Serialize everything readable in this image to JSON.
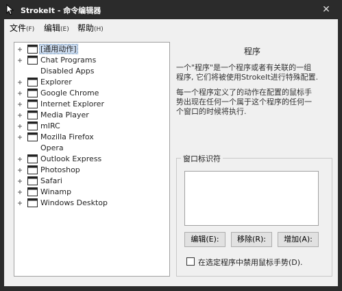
{
  "titlebar": {
    "title": "StrokeIt - 命令编辑器",
    "close_label": "✕"
  },
  "menubar": {
    "items": [
      {
        "label": "文件",
        "accel": "(F)"
      },
      {
        "label": "编辑",
        "accel": "(E)"
      },
      {
        "label": "帮助",
        "accel": "(H)"
      }
    ]
  },
  "tree": {
    "items": [
      {
        "label": "[通用动作]",
        "expandable": true,
        "selected": true
      },
      {
        "label": "Chat Programs",
        "expandable": true
      },
      {
        "label": "Disabled Apps",
        "expandable": false
      },
      {
        "label": "Explorer",
        "expandable": true
      },
      {
        "label": "Google Chrome",
        "expandable": true
      },
      {
        "label": "Internet Explorer",
        "expandable": true
      },
      {
        "label": "Media Player",
        "expandable": true
      },
      {
        "label": "mIRC",
        "expandable": true
      },
      {
        "label": "Mozilla Firefox",
        "expandable": true
      },
      {
        "label": "Opera",
        "expandable": false
      },
      {
        "label": "Outlook Express",
        "expandable": true
      },
      {
        "label": "Photoshop",
        "expandable": true
      },
      {
        "label": "Safari",
        "expandable": true
      },
      {
        "label": "Winamp",
        "expandable": true
      },
      {
        "label": "Windows Desktop",
        "expandable": true
      }
    ]
  },
  "panel": {
    "heading": "程序",
    "paragraph1_lines": [
      "一个\"程序\"是一个程序或者有关联的一组",
      "程序, 它们将被使用StrokeIt进行特殊配置."
    ],
    "paragraph2_lines": [
      "每一个程序定义了的动作在配置的鼠标手",
      "势出现在任何一个属于这个程序的任何一",
      "个窗口的时候将执行."
    ],
    "group_label": "窗口标识符",
    "buttons": {
      "edit": "编辑(E):",
      "remove": "移除(R):",
      "add": "增加(A):"
    },
    "checkbox_label": "在选定程序中禁用鼠标手势(D)."
  }
}
